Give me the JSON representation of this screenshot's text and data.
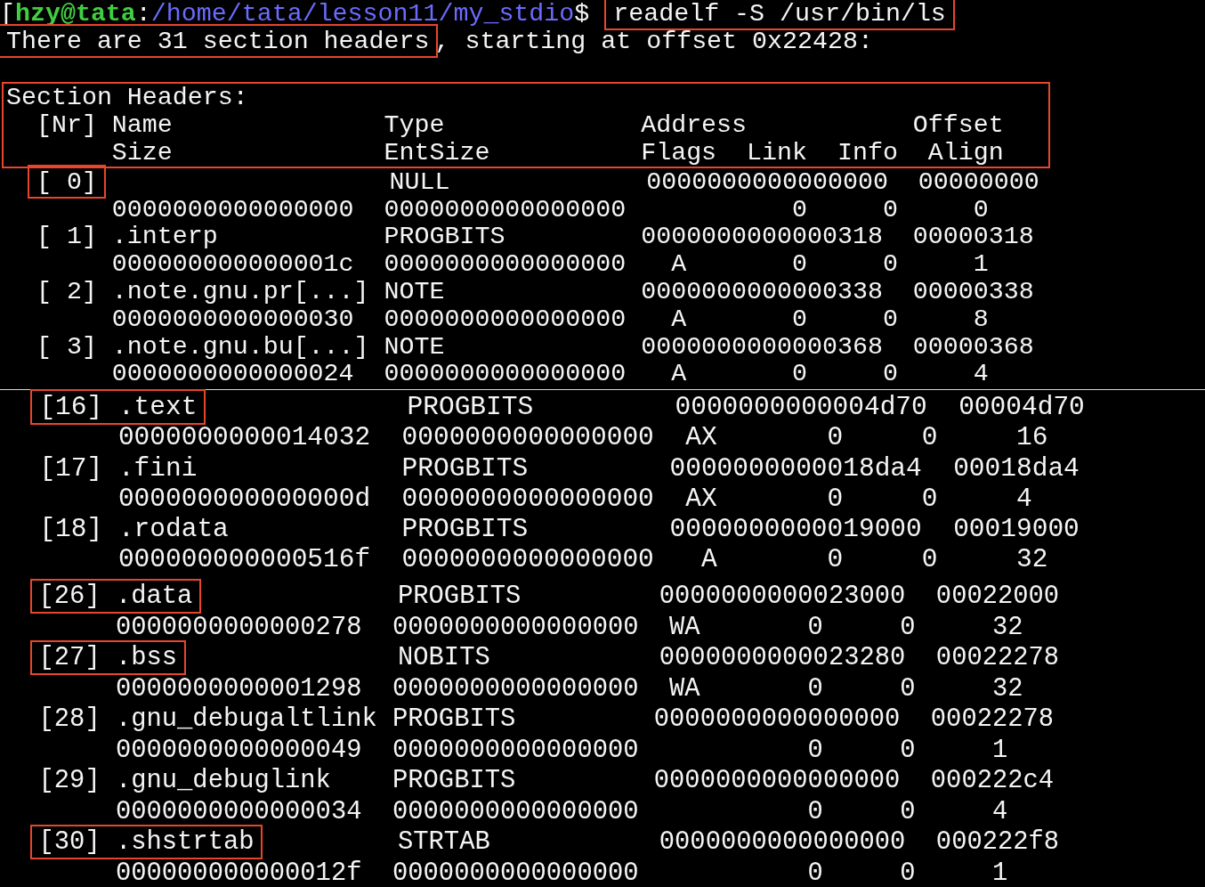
{
  "terminal": {
    "prompt": {
      "bracket": "[",
      "user_host": "hzy@tata",
      "separator": ":",
      "path": "/home/tata/lesson11/my_stdio",
      "symbol": "$",
      "command": "readelf -S /usr/bin/ls",
      "command_highlighted": true
    },
    "summary": [
      {
        "text": "There are 31 section headers",
        "highlighted": true
      },
      {
        "text": ", starting at offset 0x22428:",
        "highlighted": false
      }
    ],
    "header_block": {
      "highlighted": true,
      "lines": [
        {
          "kind": "title",
          "text": "Section Headers:"
        },
        {
          "kind": "entry",
          "text": "[Nr] Name              Type             Address           Offset"
        },
        {
          "kind": "detail",
          "text": "Size              EntSize          Flags  Link  Info  Align"
        }
      ]
    },
    "panels": [
      {
        "kind": "top",
        "lines": [
          {
            "kind": "entry",
            "segments": [
              {
                "text": "[ 0]",
                "highlighted": true
              },
              {
                "text": "                   NULL             0000000000000000  00000000",
                "highlighted": false
              }
            ]
          },
          {
            "kind": "detail",
            "segments": [
              {
                "text": "0000000000000000  0000000000000000           0     0     0",
                "highlighted": false
              }
            ]
          },
          {
            "kind": "entry",
            "segments": [
              {
                "text": "[ 1] .interp           PROGBITS         0000000000000318  00000318",
                "highlighted": false
              }
            ]
          },
          {
            "kind": "detail",
            "segments": [
              {
                "text": "000000000000001c  0000000000000000   A       0     0     1",
                "highlighted": false
              }
            ]
          },
          {
            "kind": "entry",
            "segments": [
              {
                "text": "[ 2] .note.gnu.pr[...] NOTE             0000000000000338  00000338",
                "highlighted": false
              }
            ]
          },
          {
            "kind": "detail",
            "segments": [
              {
                "text": "0000000000000030  0000000000000000   A       0     0     8",
                "highlighted": false
              }
            ]
          },
          {
            "kind": "entry",
            "segments": [
              {
                "text": "[ 3] .note.gnu.bu[...] NOTE             0000000000000368  00000368",
                "highlighted": false
              }
            ]
          },
          {
            "kind": "detail",
            "segments": [
              {
                "text": "0000000000000024  0000000000000000   A       0     0     4",
                "highlighted": false
              }
            ]
          }
        ]
      },
      {
        "kind": "middle",
        "lines": [
          {
            "kind": "entry",
            "segments": [
              {
                "text": "[16] .text",
                "highlighted": true
              },
              {
                "text": "             PROGBITS         0000000000004d70  00004d70",
                "highlighted": false
              }
            ]
          },
          {
            "kind": "detail",
            "segments": [
              {
                "text": "0000000000014032  0000000000000000  AX       0     0     16",
                "highlighted": false
              }
            ]
          },
          {
            "kind": "entry",
            "segments": [
              {
                "text": "[17] .fini             PROGBITS         0000000000018da4  00018da4",
                "highlighted": false
              }
            ]
          },
          {
            "kind": "detail",
            "segments": [
              {
                "text": "000000000000000d  0000000000000000  AX       0     0     4",
                "highlighted": false
              }
            ]
          },
          {
            "kind": "entry",
            "segments": [
              {
                "text": "[18] .rodata           PROGBITS         0000000000019000  00019000",
                "highlighted": false
              }
            ]
          },
          {
            "kind": "detail",
            "segments": [
              {
                "text": "000000000000516f  0000000000000000   A       0     0     32",
                "highlighted": false
              }
            ]
          }
        ]
      },
      {
        "kind": "bottom",
        "lines": [
          {
            "kind": "entry",
            "segments": [
              {
                "text": "[26] .data",
                "highlighted": true
              },
              {
                "text": "             PROGBITS         0000000000023000  00022000",
                "highlighted": false
              }
            ]
          },
          {
            "kind": "detail",
            "segments": [
              {
                "text": "0000000000000278  0000000000000000  WA       0     0     32",
                "highlighted": false
              }
            ]
          },
          {
            "kind": "entry",
            "segments": [
              {
                "text": "[27] .bss",
                "highlighted": true
              },
              {
                "text": "              NOBITS           0000000000023280  00022278",
                "highlighted": false
              }
            ]
          },
          {
            "kind": "detail",
            "segments": [
              {
                "text": "0000000000001298  0000000000000000  WA       0     0     32",
                "highlighted": false
              }
            ]
          },
          {
            "kind": "entry",
            "segments": [
              {
                "text": "[28] .gnu_debugaltlink PROGBITS         0000000000000000  00022278",
                "highlighted": false
              }
            ]
          },
          {
            "kind": "detail",
            "segments": [
              {
                "text": "0000000000000049  0000000000000000           0     0     1",
                "highlighted": false
              }
            ]
          },
          {
            "kind": "entry",
            "segments": [
              {
                "text": "[29] .gnu_debuglink    PROGBITS         0000000000000000  000222c4",
                "highlighted": false
              }
            ]
          },
          {
            "kind": "detail",
            "segments": [
              {
                "text": "0000000000000034  0000000000000000           0     0     4",
                "highlighted": false
              }
            ]
          },
          {
            "kind": "entry",
            "segments": [
              {
                "text": "[30] .shstrtab",
                "highlighted": true
              },
              {
                "text": "         STRTAB           0000000000000000  000222f8",
                "highlighted": false
              }
            ]
          },
          {
            "kind": "detail",
            "segments": [
              {
                "text": "000000000000012f  0000000000000000           0     0     1",
                "highlighted": false
              }
            ]
          }
        ]
      }
    ]
  }
}
